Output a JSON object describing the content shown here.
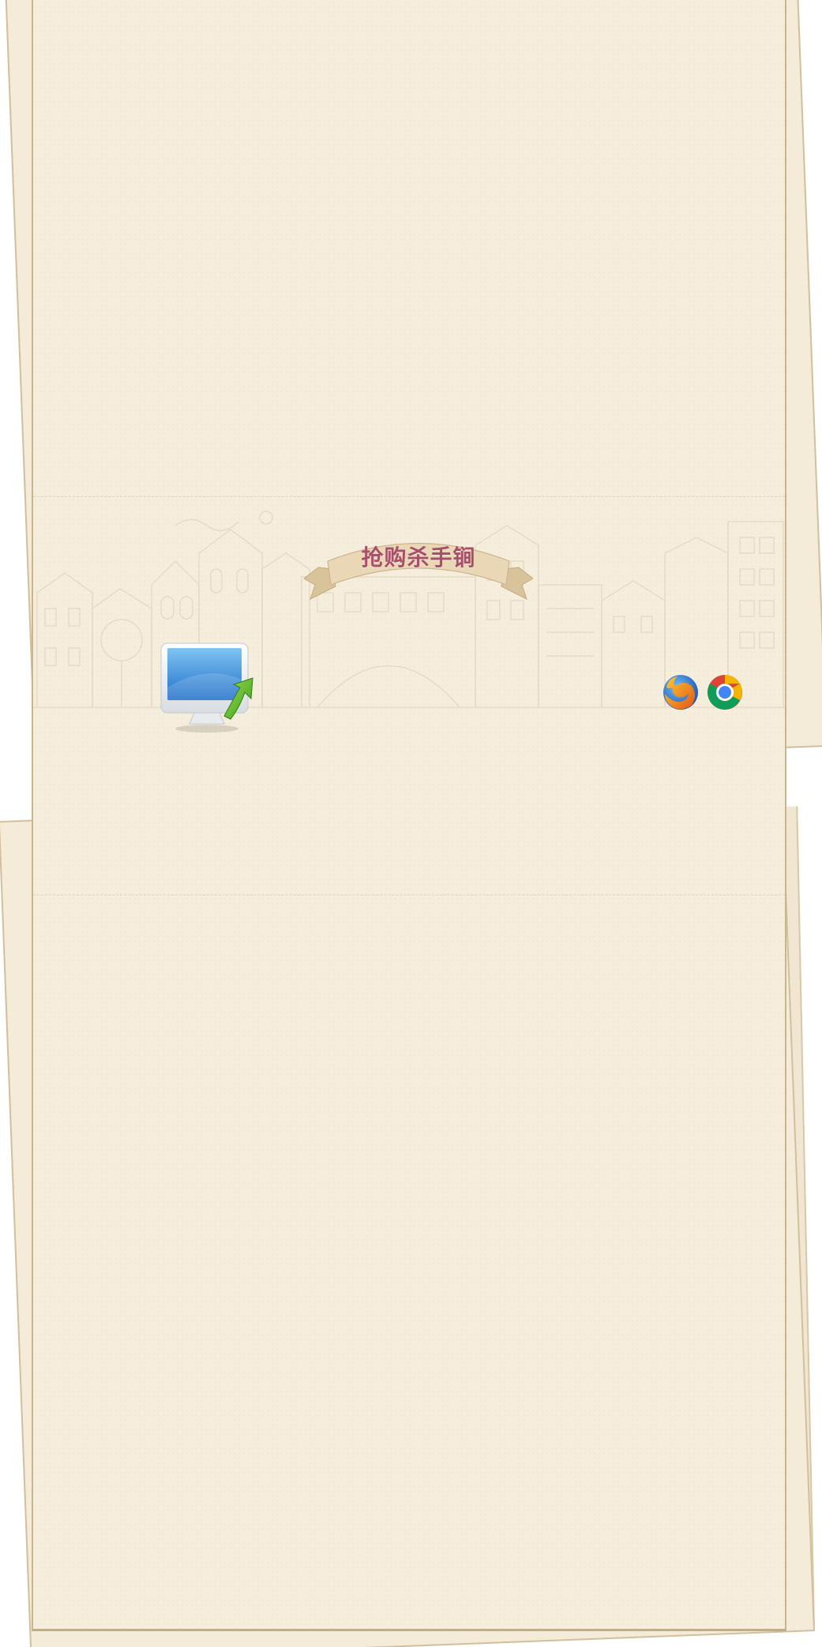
{
  "banner": {
    "title": "抢购杀手锏"
  },
  "download": {
    "icon": "computer-upgrade-icon"
  },
  "browsers": [
    {
      "name": "firefox",
      "icon": "firefox-icon"
    },
    {
      "name": "chrome",
      "icon": "chrome-icon"
    }
  ],
  "colors": {
    "paper": "#f6eedd",
    "paper_border": "#c9b48b",
    "ribbon": "#e6d4b4",
    "ribbon_text": "#a8506a"
  }
}
